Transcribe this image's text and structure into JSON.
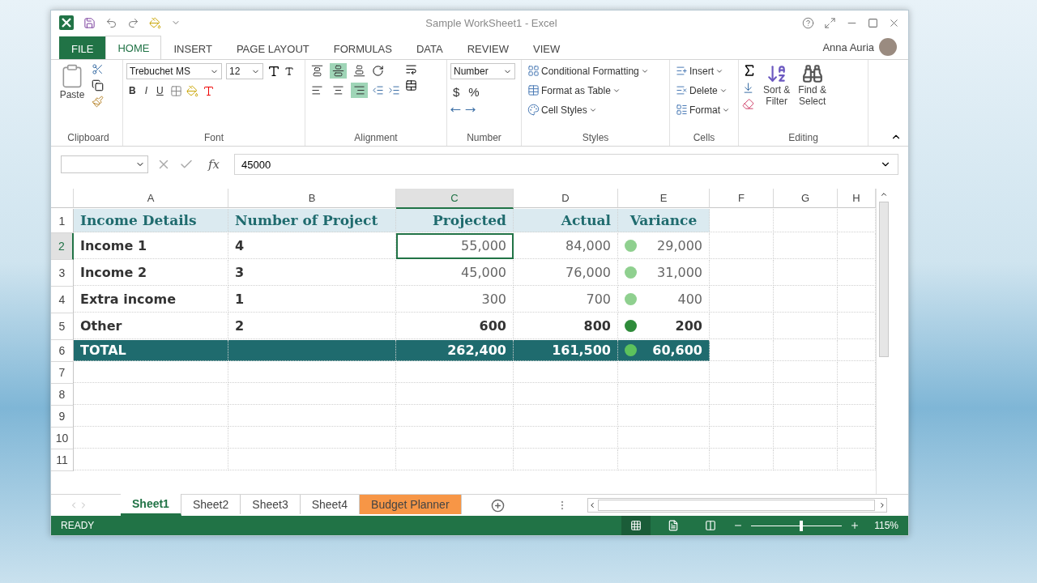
{
  "window": {
    "title": "Sample WorkSheet1 - Excel",
    "user": "Anna Auria"
  },
  "ribbon_tabs": [
    {
      "label": "FILE",
      "kind": "file",
      "selected": false
    },
    {
      "label": "HOME",
      "kind": "tab",
      "selected": true
    },
    {
      "label": "INSERT",
      "kind": "tab",
      "selected": false
    },
    {
      "label": "PAGE LAYOUT",
      "kind": "tab",
      "selected": false
    },
    {
      "label": "FORMULAS",
      "kind": "tab",
      "selected": false
    },
    {
      "label": "DATA",
      "kind": "tab",
      "selected": false
    },
    {
      "label": "REVIEW",
      "kind": "tab",
      "selected": false
    },
    {
      "label": "VIEW",
      "kind": "tab",
      "selected": false
    }
  ],
  "ribbon": {
    "clipboard": {
      "paste": "Paste",
      "label": "Clipboard"
    },
    "font": {
      "name": "Trebuchet MS",
      "size": "12",
      "bold": "B",
      "italic": "I",
      "underline": "U",
      "label": "Font"
    },
    "alignment": {
      "vertical": [
        {
          "selected": false
        },
        {
          "selected": true
        },
        {
          "selected": false
        }
      ],
      "horizontal": [
        {
          "selected": false
        },
        {
          "selected": false
        },
        {
          "selected": true
        }
      ],
      "label": "Alignment"
    },
    "number": {
      "format": "Number",
      "currency": "$",
      "percent": "%",
      "label": "Number"
    },
    "styles": {
      "items": [
        "Conditional Formatting",
        "Format as Table",
        "Cell Styles"
      ],
      "label": "Styles"
    },
    "cells": {
      "items": [
        "Insert",
        "Delete",
        "Format"
      ],
      "label": "Cells"
    },
    "editing": {
      "sort": [
        "Sort &",
        "Filter"
      ],
      "find": [
        "Find &",
        "Select"
      ],
      "label": "Editing"
    }
  },
  "formula_bar": {
    "function_label": "fx",
    "value": "45000"
  },
  "columns": [
    {
      "label": "A",
      "selected": false
    },
    {
      "label": "B",
      "selected": false
    },
    {
      "label": "C",
      "selected": true
    },
    {
      "label": "D",
      "selected": false
    },
    {
      "label": "E",
      "selected": false
    },
    {
      "label": "F",
      "selected": false
    },
    {
      "label": "G",
      "selected": false
    },
    {
      "label": "H",
      "selected": false
    }
  ],
  "rows": [
    {
      "header": "1",
      "kind": "header",
      "selected": false,
      "cells": {
        "A": "Income Details",
        "B": "Number of Project",
        "C": "Projected",
        "D": "Actual",
        "E": "Variance"
      }
    },
    {
      "header": "2",
      "kind": "data",
      "selected": true,
      "cells": {
        "A": "Income 1",
        "B": "4",
        "C": "55,000",
        "D": "84,000",
        "E": "29,000"
      },
      "color": "#8fd08f"
    },
    {
      "header": "3",
      "kind": "data",
      "selected": false,
      "cells": {
        "A": "Income 2",
        "B": "3",
        "C": "45,000",
        "D": "76,000",
        "E": "31,000"
      },
      "color": "#8fd08f"
    },
    {
      "header": "4",
      "kind": "data",
      "selected": false,
      "cells": {
        "A": "Extra income",
        "B": "1",
        "C": "300",
        "D": "700",
        "E": "400"
      },
      "color": "#8fd08f"
    },
    {
      "header": "5",
      "kind": "data",
      "selected": false,
      "cells": {
        "A": "Other",
        "B": "2",
        "C": "600",
        "D": "800",
        "E": "200"
      },
      "color": "#2e8b3a"
    },
    {
      "header": "6",
      "kind": "total",
      "selected": false,
      "cells": {
        "A": "TOTAL",
        "C": "262,400",
        "D": "161,500",
        "E": "60,600"
      },
      "color": "#5cc25c"
    },
    {
      "header": "7",
      "kind": "empty",
      "selected": false
    },
    {
      "header": "8",
      "kind": "empty",
      "selected": false
    },
    {
      "header": "9",
      "kind": "empty",
      "selected": false
    },
    {
      "header": "10",
      "kind": "empty",
      "selected": false
    },
    {
      "header": "11",
      "kind": "empty",
      "selected": false
    }
  ],
  "sheet_tabs": [
    {
      "label": "Sheet1",
      "selected": true
    },
    {
      "label": "Sheet2",
      "selected": false
    },
    {
      "label": "Sheet3",
      "selected": false
    },
    {
      "label": "Sheet4",
      "selected": false
    },
    {
      "label": "Budget Planner",
      "selected": false,
      "color": "#f79646"
    }
  ],
  "status_bar": {
    "status": "READY",
    "views": [
      {
        "selected": true
      },
      {
        "selected": false
      },
      {
        "selected": false
      }
    ],
    "zoom": {
      "level": 0.55,
      "reading": "115%"
    }
  }
}
